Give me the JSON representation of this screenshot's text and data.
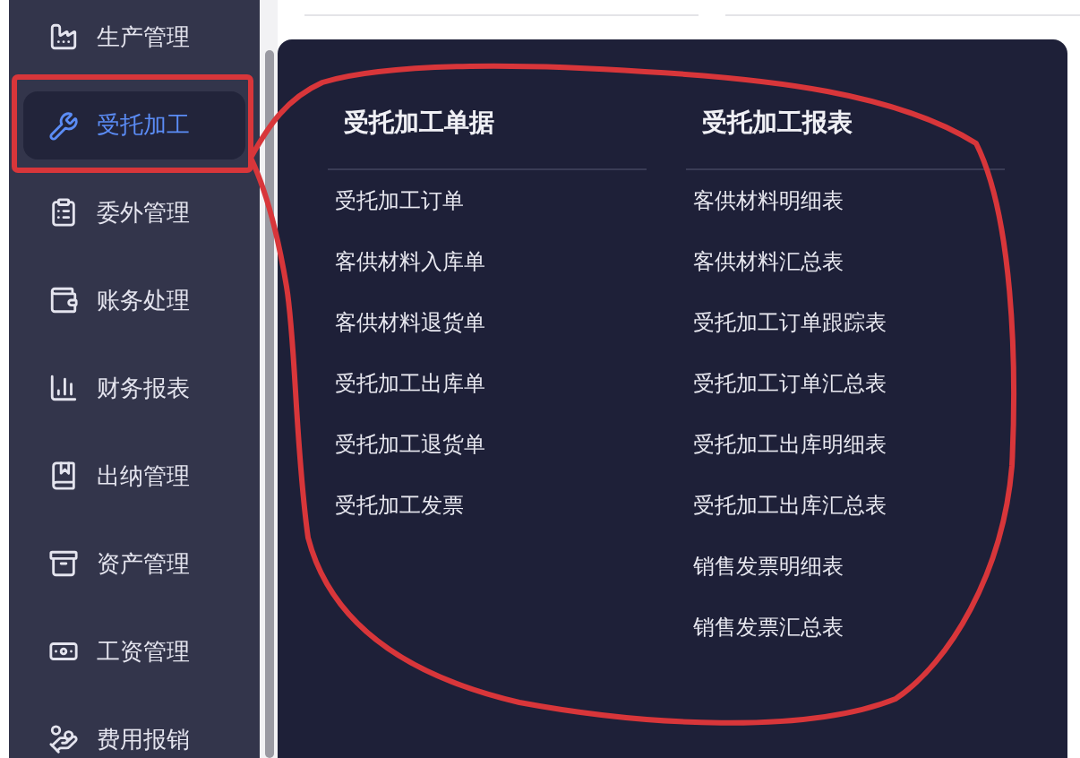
{
  "sidebar": {
    "items": [
      {
        "label": "生产管理",
        "selected": false
      },
      {
        "label": "受托加工",
        "selected": true
      },
      {
        "label": "委外管理",
        "selected": false
      },
      {
        "label": "账务处理",
        "selected": false
      },
      {
        "label": "财务报表",
        "selected": false
      },
      {
        "label": "出纳管理",
        "selected": false
      },
      {
        "label": "资产管理",
        "selected": false
      },
      {
        "label": "工资管理",
        "selected": false
      },
      {
        "label": "费用报销",
        "selected": false
      }
    ]
  },
  "flyout": {
    "columns": [
      {
        "title": "受托加工单据",
        "items": [
          "受托加工订单",
          "客供材料入库单",
          "客供材料退货单",
          "受托加工出库单",
          "受托加工退货单",
          "受托加工发票"
        ]
      },
      {
        "title": "受托加工报表",
        "items": [
          "客供材料明细表",
          "客供材料汇总表",
          "受托加工订单跟踪表",
          "受托加工订单汇总表",
          "受托加工出库明细表",
          "受托加工出库汇总表",
          "销售发票明细表",
          "销售发票汇总表"
        ]
      }
    ]
  }
}
